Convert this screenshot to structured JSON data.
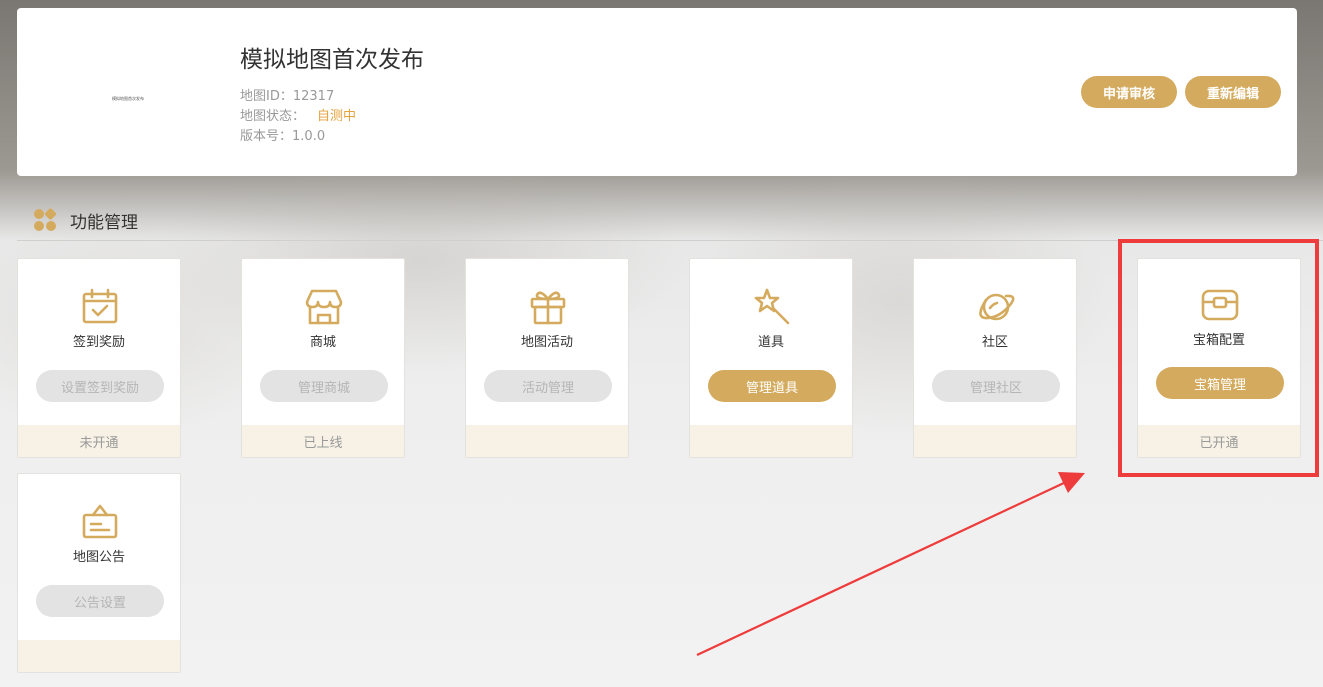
{
  "header": {
    "thumbnail_text": "模拟地图首次发布",
    "title": "模拟地图首次发布",
    "id_label": "地图ID：",
    "id_value": "12317",
    "status_label": "地图状态：",
    "status_value": "自测中",
    "version_label": "版本号：",
    "version_value": "1.0.0",
    "apply_review_button": "申请审核",
    "re_edit_button": "重新编辑"
  },
  "section": {
    "title": "功能管理"
  },
  "features": [
    {
      "name": "签到奖励",
      "button": "设置签到奖励",
      "button_enabled": false,
      "footer": "未开通",
      "icon": "calendar-check-icon"
    },
    {
      "name": "商城",
      "button": "管理商城",
      "button_enabled": false,
      "footer": "已上线",
      "icon": "store-icon"
    },
    {
      "name": "地图活动",
      "button": "活动管理",
      "button_enabled": false,
      "footer": "",
      "icon": "gift-icon"
    },
    {
      "name": "道具",
      "button": "管理道具",
      "button_enabled": true,
      "footer": "",
      "icon": "magic-wand-icon"
    },
    {
      "name": "社区",
      "button": "管理社区",
      "button_enabled": false,
      "footer": "",
      "icon": "planet-icon"
    },
    {
      "name": "宝箱配置",
      "button": "宝箱管理",
      "button_enabled": true,
      "footer": "已开通",
      "icon": "treasure-chest-icon"
    },
    {
      "name": "地图公告",
      "button": "公告设置",
      "button_enabled": false,
      "footer": "",
      "icon": "notice-board-icon"
    }
  ],
  "colors": {
    "accent": "#d4ab5e",
    "status_warning": "#e6a23c",
    "disabled_button": "#e3e3e3",
    "footer_bg": "#f8f2e6",
    "annotation_red": "#ee3b3b"
  }
}
